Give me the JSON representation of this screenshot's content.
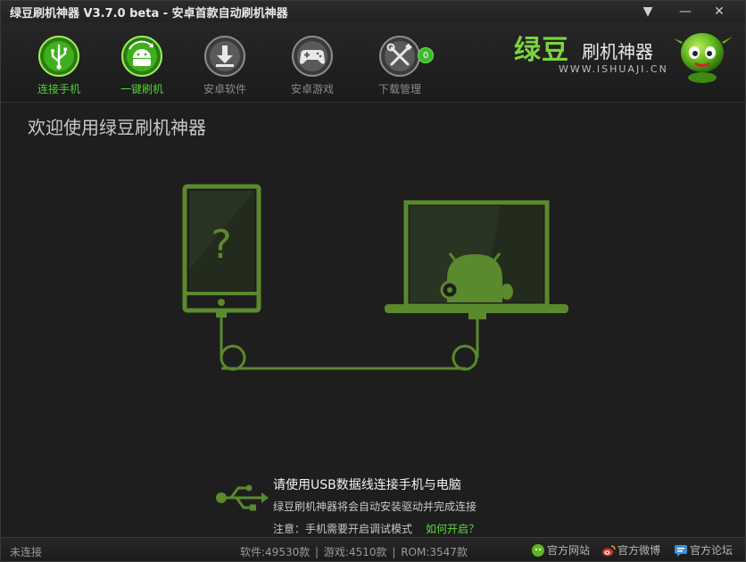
{
  "window": {
    "title": "绿豆刷机神器 V3.7.0 beta - 安卓首款自动刷机神器",
    "menu_glyph": "▼",
    "min_glyph": "—",
    "close_glyph": "✕"
  },
  "toolbar": {
    "items": [
      {
        "label": "连接手机",
        "icon": "usb-icon",
        "active": true
      },
      {
        "label": "一键刷机",
        "icon": "android-refresh-icon",
        "active": true
      },
      {
        "label": "安卓软件",
        "icon": "download-icon",
        "active": false
      },
      {
        "label": "安卓游戏",
        "icon": "gamepad-icon",
        "active": false
      },
      {
        "label": "下载管理",
        "icon": "tools-icon",
        "active": false
      }
    ],
    "download_badge": "0"
  },
  "logo": {
    "main": "绿豆",
    "sub": "刷机神器",
    "url": "WWW.ISHUAJI.CN"
  },
  "main": {
    "page_title": "欢迎使用绿豆刷机神器",
    "phone_mark": "?",
    "hint_line1": "请使用USB数据线连接手机与电脑",
    "hint_line2": "绿豆刷机神器将会自动安装驱动并完成连接",
    "hint_line3": "注意：手机需要开启调试模式",
    "hint_link": "如何开启？"
  },
  "status": {
    "connection": "未连接",
    "software": "软件:49530款",
    "games": "游戏:4510款",
    "rom": "ROM:3547款",
    "sep": "|",
    "links": [
      "官方网站",
      "官方微博",
      "官方论坛"
    ]
  },
  "colors": {
    "accent": "#4fd232",
    "line_art": "#5a8a2c",
    "bg": "#1e1e1e"
  }
}
